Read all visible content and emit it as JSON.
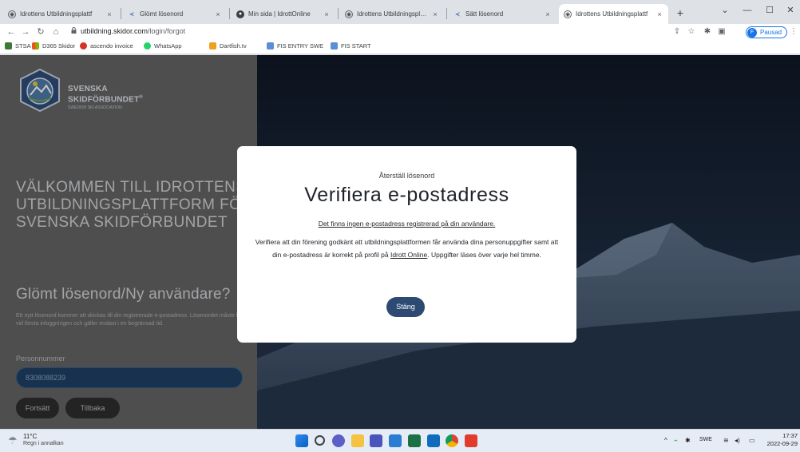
{
  "browser": {
    "tabs": [
      {
        "title": "Idrottens Utbildningsplattf",
        "active": false
      },
      {
        "title": "Glömt lösenord",
        "active": false
      },
      {
        "title": "Min sida | IdrottOnline",
        "active": false
      },
      {
        "title": "Idrottens Utbildningsplattf",
        "active": false
      },
      {
        "title": "Sätt lösenord",
        "active": false
      },
      {
        "title": "Idrottens Utbildningsplattf",
        "active": true
      }
    ],
    "tab_close": "×",
    "new_tab": "+",
    "url_host": "utbildning.skidor.com",
    "url_path": "/login/forgot",
    "profile_initial": "F",
    "profile_label": "Pausad",
    "bookmarks": [
      {
        "label": "STSA",
        "color": "#3d7a3a"
      },
      {
        "label": "D365 Skidor",
        "color": "#f25022"
      },
      {
        "label": "ascendo invoice",
        "color": "#d93025"
      },
      {
        "label": "WhatsApp",
        "color": "#25d366"
      },
      {
        "label": "Dartfish.tv",
        "color": "#f0a020"
      },
      {
        "label": "FIS ENTRY SWE",
        "color": "#5b8dd9"
      },
      {
        "label": "FIS START",
        "color": "#5b8dd9"
      }
    ]
  },
  "sidebar": {
    "logo_name_line1": "SVENSKA",
    "logo_name_line2": "SKIDFÖRBUNDET",
    "logo_registered": "®",
    "logo_sub": "SWEDISH SKI ASSOCIATION",
    "welcome": "VÄLKOMMEN TILL IDROTTENS UTBILDNINGSPLATTFORM FÖR SVENSKA SKIDFÖRBUNDET",
    "forgot_title": "Glömt lösenord/Ny användare?",
    "forgot_desc": "Ett nytt lösenord kommer att skickas till din registrerade e-postadress. Lösenordet måste bytas vid första inloggningen och gäller endast i en begränsad tid.",
    "field_label": "Personnummer",
    "field_value": "8308088239",
    "continue_label": "Fortsätt",
    "back_label": "Tillbaka"
  },
  "modal": {
    "kicker": "Återställ lösenord",
    "title": "Verifiera e-postadress",
    "link_text": "Det finns ingen e-postadress registrerad på din användare.",
    "body_part1": "Verifiera att din förening godkänt att utbildningsplattformen får använda dina personuppgifter samt att din e-postadress är korrekt på profil på ",
    "body_link": "Idrott Online",
    "body_part2": ". Uppgifter läses över varje hel timme.",
    "close_label": "Stäng"
  },
  "taskbar": {
    "temperature": "11°C",
    "weather": "Regn i annalkan",
    "language": "SWE",
    "time": "17:37",
    "date": "2022-09-29",
    "tray_chevron": "^"
  },
  "colors": {
    "sidebar_bg": "#646464",
    "input_bg": "#1e3f66",
    "modal_button": "#2d4a73"
  }
}
